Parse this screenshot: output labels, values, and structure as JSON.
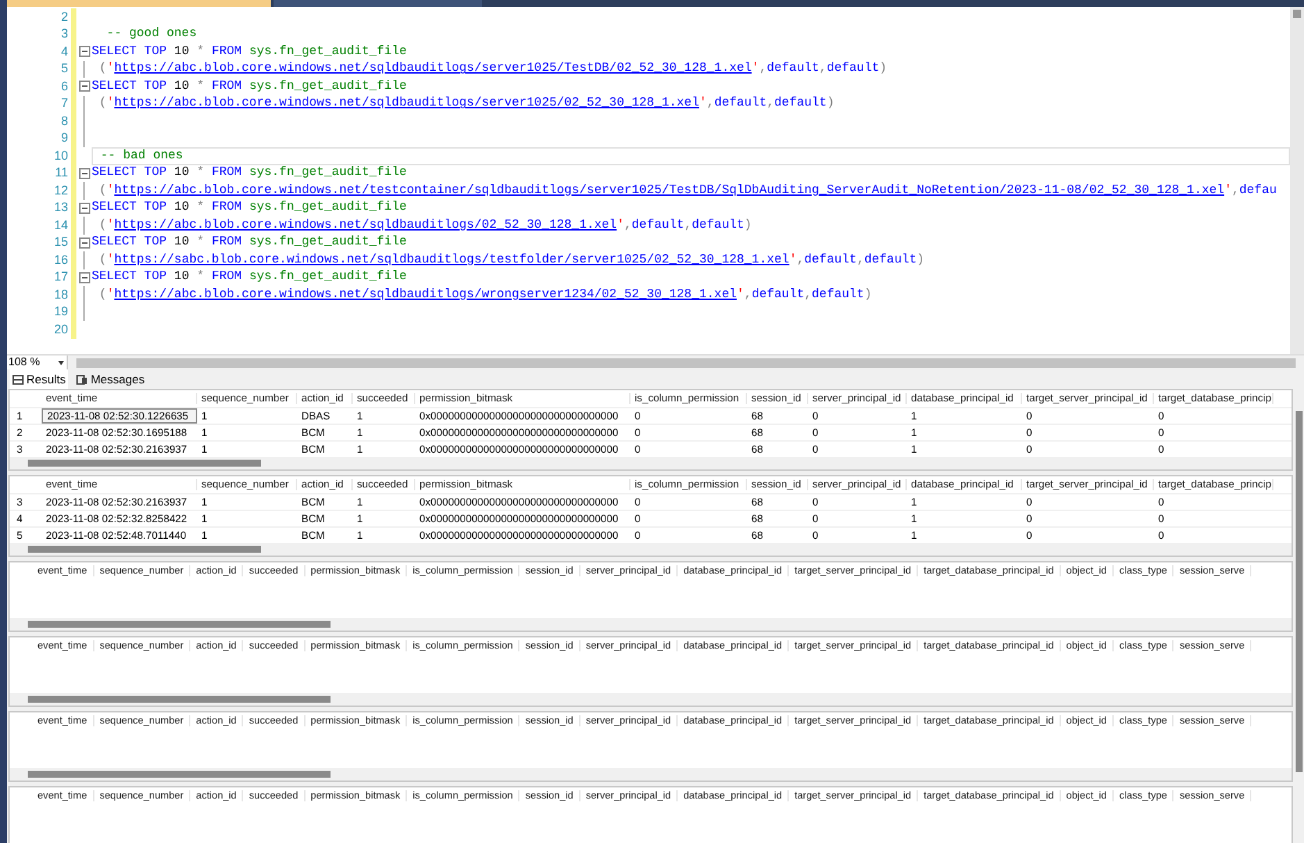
{
  "editor": {
    "lines": [
      {
        "number": "2",
        "kind": "plain",
        "current": false
      },
      {
        "number": "3",
        "kind": "plain",
        "current": false,
        "segments": [
          {
            "kind": "comment",
            "text": "  -- good ones"
          }
        ]
      },
      {
        "number": "4",
        "kind": "start",
        "current": false,
        "segments": [
          {
            "kind": "keyword",
            "text": "SELECT TOP "
          },
          {
            "kind": "plain",
            "text": "10 "
          },
          {
            "kind": "op",
            "text": "* "
          },
          {
            "kind": "keyword",
            "text": "FROM "
          },
          {
            "kind": "func",
            "text": "sys.fn_get_audit_file"
          }
        ]
      },
      {
        "number": "5",
        "kind": "inner",
        "current": false,
        "segments": [
          {
            "kind": "op",
            "text": " ("
          },
          {
            "kind": "str",
            "text": "'"
          },
          {
            "kind": "link",
            "text": "https://abc.blob.core.windows.net/sqldbauditlogs/server1025/TestDB/02_52_30_128_1.xel"
          },
          {
            "kind": "str",
            "text": "'"
          },
          {
            "kind": "op",
            "text": ","
          },
          {
            "kind": "keyword",
            "text": "default"
          },
          {
            "kind": "op",
            "text": ","
          },
          {
            "kind": "keyword",
            "text": "default"
          },
          {
            "kind": "op",
            "text": ")"
          }
        ]
      },
      {
        "number": "6",
        "kind": "start",
        "current": false,
        "segments": [
          {
            "kind": "keyword",
            "text": "SELECT TOP "
          },
          {
            "kind": "plain",
            "text": "10 "
          },
          {
            "kind": "op",
            "text": "* "
          },
          {
            "kind": "keyword",
            "text": "FROM "
          },
          {
            "kind": "func",
            "text": "sys.fn_get_audit_file"
          }
        ]
      },
      {
        "number": "7",
        "kind": "inner",
        "current": false,
        "segments": [
          {
            "kind": "op",
            "text": " ("
          },
          {
            "kind": "str",
            "text": "'"
          },
          {
            "kind": "link",
            "text": "https://abc.blob.core.windows.net/sqldbauditlogs/server1025/02_52_30_128_1.xel"
          },
          {
            "kind": "str",
            "text": "'"
          },
          {
            "kind": "op",
            "text": ","
          },
          {
            "kind": "keyword",
            "text": "default"
          },
          {
            "kind": "op",
            "text": ","
          },
          {
            "kind": "keyword",
            "text": "default"
          },
          {
            "kind": "op",
            "text": ")"
          }
        ]
      },
      {
        "number": "8",
        "kind": "inner",
        "current": false
      },
      {
        "number": "9",
        "kind": "inner",
        "current": false
      },
      {
        "number": "10",
        "kind": "plain",
        "current": true,
        "segments": [
          {
            "kind": "comment",
            "text": " -- bad ones"
          }
        ]
      },
      {
        "number": "11",
        "kind": "start",
        "current": false,
        "segments": [
          {
            "kind": "keyword",
            "text": "SELECT TOP "
          },
          {
            "kind": "plain",
            "text": "10 "
          },
          {
            "kind": "op",
            "text": "* "
          },
          {
            "kind": "keyword",
            "text": "FROM "
          },
          {
            "kind": "func",
            "text": "sys.fn_get_audit_file"
          }
        ]
      },
      {
        "number": "12",
        "kind": "inner",
        "current": false,
        "segments": [
          {
            "kind": "op",
            "text": " ("
          },
          {
            "kind": "str",
            "text": "'"
          },
          {
            "kind": "link",
            "text": "https://abc.blob.core.windows.net/testcontainer/sqldbauditlogs/server1025/TestDB/SqlDbAuditing_ServerAudit_NoRetention/2023-11-08/02_52_30_128_1.xel"
          },
          {
            "kind": "str",
            "text": "'"
          },
          {
            "kind": "op",
            "text": ","
          },
          {
            "kind": "keyword",
            "text": "defau"
          }
        ]
      },
      {
        "number": "13",
        "kind": "start",
        "current": false,
        "segments": [
          {
            "kind": "keyword",
            "text": "SELECT TOP "
          },
          {
            "kind": "plain",
            "text": "10 "
          },
          {
            "kind": "op",
            "text": "* "
          },
          {
            "kind": "keyword",
            "text": "FROM "
          },
          {
            "kind": "func",
            "text": "sys.fn_get_audit_file"
          }
        ]
      },
      {
        "number": "14",
        "kind": "inner",
        "current": false,
        "segments": [
          {
            "kind": "op",
            "text": " ("
          },
          {
            "kind": "str",
            "text": "'"
          },
          {
            "kind": "link",
            "text": "https://abc.blob.core.windows.net/sqldbauditlogs/02_52_30_128_1.xel"
          },
          {
            "kind": "str",
            "text": "'"
          },
          {
            "kind": "op",
            "text": ","
          },
          {
            "kind": "keyword",
            "text": "default"
          },
          {
            "kind": "op",
            "text": ","
          },
          {
            "kind": "keyword",
            "text": "default"
          },
          {
            "kind": "op",
            "text": ")"
          }
        ]
      },
      {
        "number": "15",
        "kind": "start",
        "current": false,
        "segments": [
          {
            "kind": "keyword",
            "text": "SELECT TOP "
          },
          {
            "kind": "plain",
            "text": "10 "
          },
          {
            "kind": "op",
            "text": "* "
          },
          {
            "kind": "keyword",
            "text": "FROM "
          },
          {
            "kind": "func",
            "text": "sys.fn_get_audit_file"
          }
        ]
      },
      {
        "number": "16",
        "kind": "inner",
        "current": false,
        "segments": [
          {
            "kind": "op",
            "text": " ("
          },
          {
            "kind": "str",
            "text": "'"
          },
          {
            "kind": "link",
            "text": "https://sabc.blob.core.windows.net/sqldbauditlogs/testfolder/server1025/02_52_30_128_1.xel"
          },
          {
            "kind": "str",
            "text": "'"
          },
          {
            "kind": "op",
            "text": ","
          },
          {
            "kind": "keyword",
            "text": "default"
          },
          {
            "kind": "op",
            "text": ","
          },
          {
            "kind": "keyword",
            "text": "default"
          },
          {
            "kind": "op",
            "text": ")"
          }
        ]
      },
      {
        "number": "17",
        "kind": "start",
        "current": false,
        "segments": [
          {
            "kind": "keyword",
            "text": "SELECT TOP "
          },
          {
            "kind": "plain",
            "text": "10 "
          },
          {
            "kind": "op",
            "text": "* "
          },
          {
            "kind": "keyword",
            "text": "FROM "
          },
          {
            "kind": "func",
            "text": "sys.fn_get_audit_file"
          }
        ]
      },
      {
        "number": "18",
        "kind": "inner",
        "current": false,
        "segments": [
          {
            "kind": "op",
            "text": " ("
          },
          {
            "kind": "str",
            "text": "'"
          },
          {
            "kind": "link",
            "text": "https://abc.blob.core.windows.net/sqldbauditlogs/wrongserver1234/02_52_30_128_1.xel"
          },
          {
            "kind": "str",
            "text": "'"
          },
          {
            "kind": "op",
            "text": ","
          },
          {
            "kind": "keyword",
            "text": "default"
          },
          {
            "kind": "op",
            "text": ","
          },
          {
            "kind": "keyword",
            "text": "default"
          },
          {
            "kind": "op",
            "text": ")"
          }
        ]
      },
      {
        "number": "19",
        "kind": "inner",
        "current": false
      },
      {
        "number": "20",
        "kind": "plain",
        "current": false
      }
    ]
  },
  "zoom": {
    "value": "108 %"
  },
  "results_tabs": [
    {
      "label": "Results",
      "kind": "grid",
      "selected": true
    },
    {
      "label": "Messages",
      "kind": "messages",
      "selected": false
    }
  ],
  "grids": [
    {
      "columns": [
        "event_time",
        "sequence_number",
        "action_id",
        "succeeded",
        "permission_bitmask",
        "is_column_permission",
        "session_id",
        "server_principal_id",
        "database_principal_id",
        "target_server_principal_id",
        "target_database_princip"
      ],
      "rows": [
        {
          "number": "1",
          "focus_first_cell": true,
          "cells": [
            "2023-11-08 02:52:30.1226635",
            "1",
            "DBAS",
            "1",
            "0x00000000000000000000000000000000",
            "0",
            "68",
            "0",
            "1",
            "0",
            "0"
          ]
        },
        {
          "number": "2",
          "focus_first_cell": false,
          "cells": [
            "2023-11-08 02:52:30.1695188",
            "1",
            "BCM",
            "1",
            "0x00000000000000000000000000000000",
            "0",
            "68",
            "0",
            "1",
            "0",
            "0"
          ]
        },
        {
          "number": "3",
          "focus_first_cell": false,
          "cells": [
            "2023-11-08 02:52:30.2163937",
            "1",
            "BCM",
            "1",
            "0x00000000000000000000000000000000",
            "0",
            "68",
            "0",
            "1",
            "0",
            "0"
          ]
        }
      ]
    },
    {
      "columns": [
        "event_time",
        "sequence_number",
        "action_id",
        "succeeded",
        "permission_bitmask",
        "is_column_permission",
        "session_id",
        "server_principal_id",
        "database_principal_id",
        "target_server_principal_id",
        "target_database_princip"
      ],
      "rows": [
        {
          "number": "3",
          "focus_first_cell": false,
          "cells": [
            "2023-11-08 02:52:30.2163937",
            "1",
            "BCM",
            "1",
            "0x00000000000000000000000000000000",
            "0",
            "68",
            "0",
            "1",
            "0",
            "0"
          ]
        },
        {
          "number": "4",
          "focus_first_cell": false,
          "cells": [
            "2023-11-08 02:52:32.8258422",
            "1",
            "BCM",
            "1",
            "0x00000000000000000000000000000000",
            "0",
            "68",
            "0",
            "1",
            "0",
            "0"
          ]
        },
        {
          "number": "5",
          "focus_first_cell": false,
          "cells": [
            "2023-11-08 02:52:48.7011440",
            "1",
            "BCM",
            "1",
            "0x00000000000000000000000000000000",
            "0",
            "68",
            "0",
            "1",
            "0",
            "0"
          ]
        }
      ]
    },
    {
      "columns": [
        "event_time",
        "sequence_number",
        "action_id",
        "succeeded",
        "permission_bitmask",
        "is_column_permission",
        "session_id",
        "server_principal_id",
        "database_principal_id",
        "target_server_principal_id",
        "target_database_principal_id",
        "object_id",
        "class_type",
        "session_serve"
      ]
    },
    {
      "columns": [
        "event_time",
        "sequence_number",
        "action_id",
        "succeeded",
        "permission_bitmask",
        "is_column_permission",
        "session_id",
        "server_principal_id",
        "database_principal_id",
        "target_server_principal_id",
        "target_database_principal_id",
        "object_id",
        "class_type",
        "session_serve"
      ]
    },
    {
      "columns": [
        "event_time",
        "sequence_number",
        "action_id",
        "succeeded",
        "permission_bitmask",
        "is_column_permission",
        "session_id",
        "server_principal_id",
        "database_principal_id",
        "target_server_principal_id",
        "target_database_principal_id",
        "object_id",
        "class_type",
        "session_serve"
      ]
    },
    {
      "columns": [
        "event_time",
        "sequence_number",
        "action_id",
        "succeeded",
        "permission_bitmask",
        "is_column_permission",
        "session_id",
        "server_principal_id",
        "database_principal_id",
        "target_server_principal_id",
        "target_database_principal_id",
        "object_id",
        "class_type",
        "session_serve"
      ]
    }
  ]
}
